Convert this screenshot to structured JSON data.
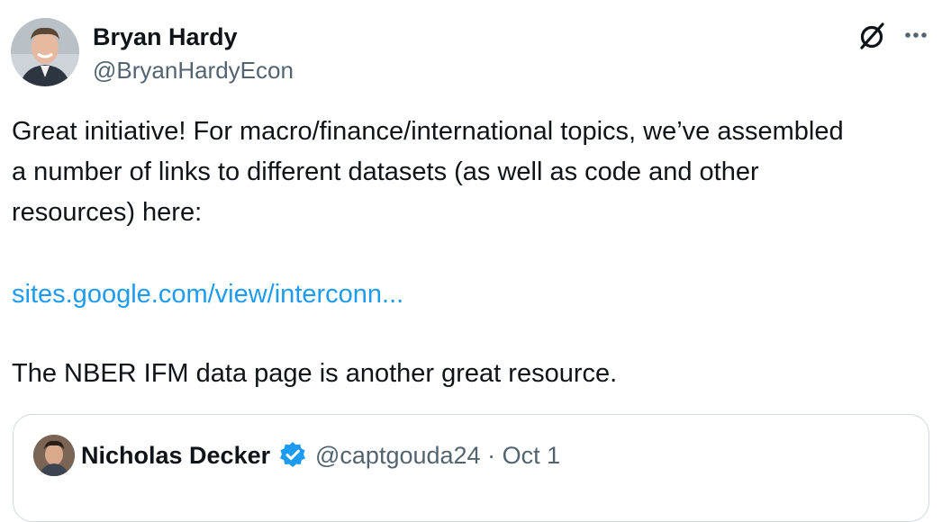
{
  "tweet": {
    "author": {
      "name": "Bryan Hardy",
      "handle": "@BryanHardyEcon",
      "avatar_icon": "profile-photo"
    },
    "actions": {
      "grok_icon": "grok-slash-circle-icon",
      "more_icon": "ellipsis-icon"
    },
    "text_lines": [
      "Great initiative! For macro/finance/international topics, we’ve assembled",
      "a number of links to different datasets (as well as code and other",
      "resources) here:"
    ],
    "link": "sites.google.com/view/interconn...",
    "closing": "The NBER IFM data page is another great resource.",
    "colors": {
      "text": "#0f1419",
      "secondary": "#536471",
      "link": "#1d9bf0",
      "border": "#cfd9de",
      "verified": "#1d9bf0"
    }
  },
  "quote": {
    "name": "Nicholas Decker",
    "handle": "@captgouda24",
    "separator": "·",
    "date": "Oct 1",
    "verified_icon": "verified-badge-icon"
  }
}
